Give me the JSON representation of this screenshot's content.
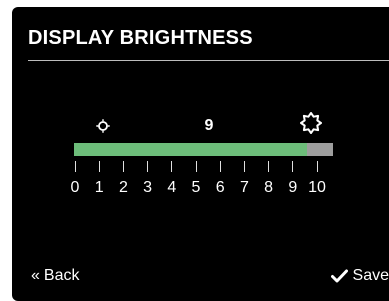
{
  "screen": {
    "title": "DISPLAY BRIGHTNESS"
  },
  "brightness": {
    "min_icon": "sun-small-icon",
    "max_icon": "sun-large-icon",
    "value_label": "9",
    "level": 9,
    "min": 0,
    "max": 10,
    "tick_labels": [
      "0",
      "1",
      "2",
      "3",
      "4",
      "5",
      "6",
      "7",
      "8",
      "9",
      "10"
    ]
  },
  "footer": {
    "back_glyph": "«",
    "back_label": "Back",
    "save_icon": "checkmark-icon",
    "save_label": "Save"
  },
  "colors": {
    "background": "#000000",
    "fill": "#6dbd7a",
    "track": "#9e9e9e",
    "text": "#ffffff"
  }
}
